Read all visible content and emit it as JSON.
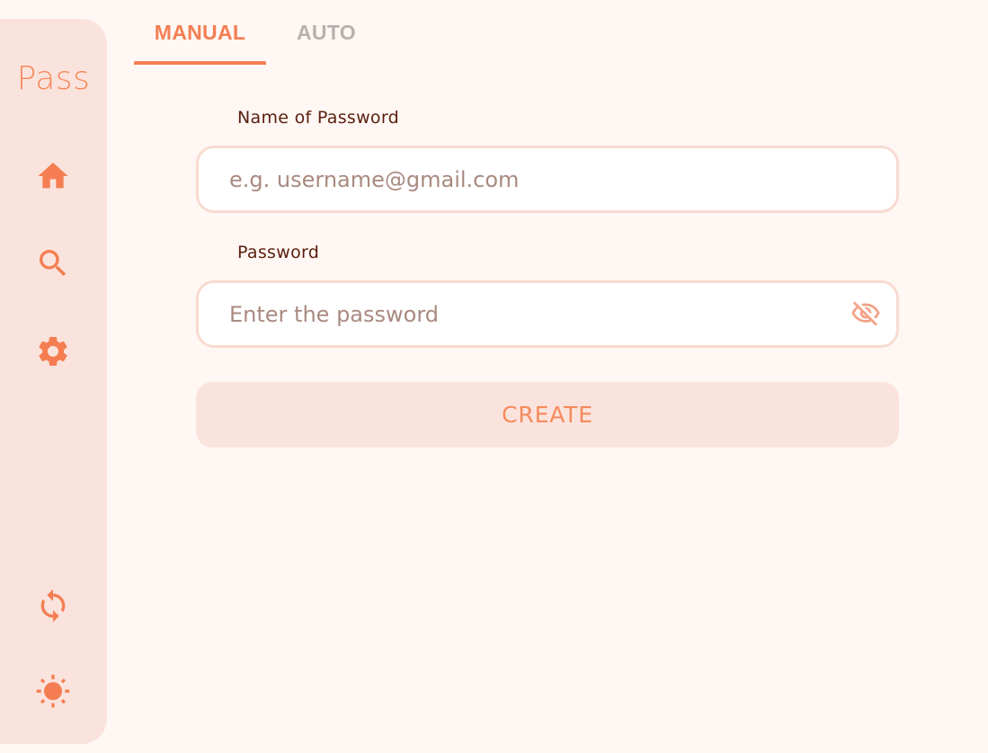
{
  "sidebar": {
    "logo_text": "Pass",
    "items": [
      {
        "icon": "home-icon",
        "label": "Home"
      },
      {
        "icon": "search-icon",
        "label": "Search"
      },
      {
        "icon": "gear-icon",
        "label": "Settings"
      }
    ],
    "bottom_items": [
      {
        "icon": "sync-icon",
        "label": "Sync"
      },
      {
        "icon": "sun-icon",
        "label": "Theme"
      }
    ]
  },
  "tabs": [
    {
      "label": "MANUAL",
      "active": true
    },
    {
      "label": "AUTO",
      "active": false
    }
  ],
  "form": {
    "name_label": "Name of Password",
    "name_placeholder": "e.g. username@gmail.com",
    "name_value": "",
    "password_label": "Password",
    "password_placeholder": "Enter the password",
    "password_value": "",
    "visibility_icon": "eye-off-icon",
    "create_label": "CREATE"
  },
  "colors": {
    "accent": "#f47e52",
    "sidebar_bg": "#fbe3dd",
    "page_bg": "#fff7f4",
    "label_text": "#5a1e0c",
    "inactive_tab": "#b7b1ae"
  }
}
